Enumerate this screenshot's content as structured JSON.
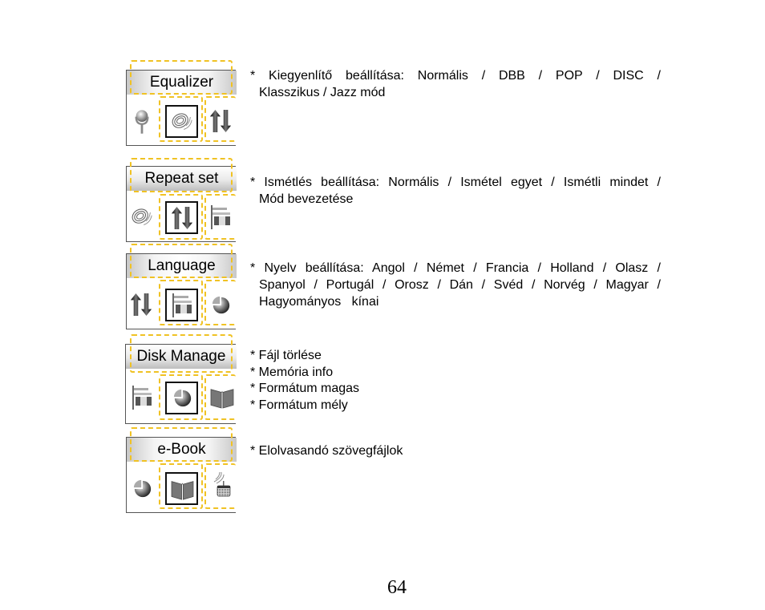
{
  "menus": [
    {
      "title": "Equalizer",
      "icons": [
        "microphone-icon",
        "sound-waves-icon",
        "repeat-arrows-icon"
      ],
      "description_lines": [
        "* Kiegyenlítő beállítása: Normális / DBB / POP / DISC /",
        "Klasszikus / Jazz mód"
      ]
    },
    {
      "title": "Repeat set",
      "icons": [
        "sound-waves-icon",
        "repeat-arrows-icon",
        "flag-language-icon"
      ],
      "description_lines": [
        "* Ismétlés beállítása: Normális / Ismétel egyet / Ismétli mindet /",
        "Mód bevezetése"
      ]
    },
    {
      "title": "Language",
      "icons": [
        "repeat-arrows-icon",
        "flag-language-icon",
        "disk-pie-icon"
      ],
      "description_lines": [
        "* Nyelv beállítása: Angol / Német / Francia / Holland / Olasz /",
        "Spanyol / Portugál / Orosz / Dán / Svéd / Norvég / Magyar /",
        "Hagyományos   kínai"
      ]
    },
    {
      "title": "Disk Manage",
      "icons": [
        "flag-language-icon",
        "disk-pie-icon",
        "book-icon"
      ],
      "description_items": [
        "* Fájl törlése",
        "* Memória info",
        "* Formátum magas",
        "* Formátum mély"
      ]
    },
    {
      "title": "e-Book",
      "icons": [
        "disk-pie-icon",
        "book-icon",
        "radio-icon"
      ],
      "description_items": [
        "* Elolvasandó szövegfájlok"
      ]
    }
  ],
  "page_number": "64",
  "colors": {
    "dash_highlight": "#f0c224",
    "border": "#555555"
  }
}
